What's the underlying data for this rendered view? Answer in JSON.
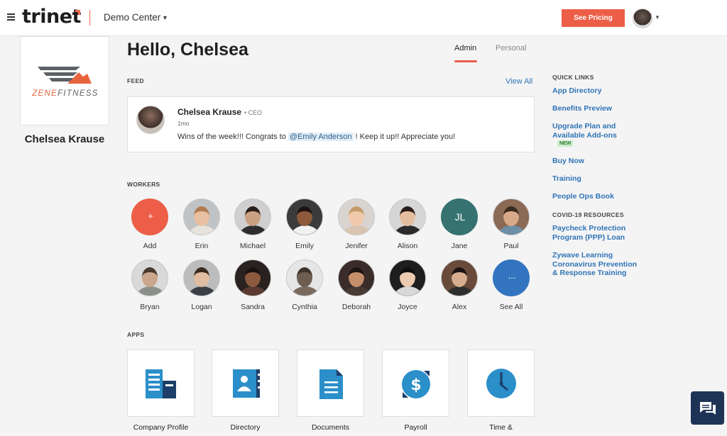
{
  "header": {
    "logo_text": "trinet",
    "demo_center_label": "Demo Center",
    "see_pricing_label": "See Pricing"
  },
  "company": {
    "logo_text_a": "ZENE",
    "logo_text_b": "FITNESS",
    "user_name": "Chelsea Krause"
  },
  "main": {
    "greeting": "Hello, Chelsea",
    "tabs": [
      {
        "label": "Admin",
        "active": true
      },
      {
        "label": "Personal",
        "active": false
      }
    ]
  },
  "feed": {
    "section_label": "FEED",
    "view_all_label": "View All",
    "post": {
      "author": "Chelsea Krause",
      "role": "• CEO",
      "time": "1mo",
      "message_before": "Wins of the week!!! Congrats to ",
      "mention": "@Emily Anderson",
      "message_after": " ! Keep it up!! Appreciate you!"
    }
  },
  "workers": {
    "section_label": "WORKERS",
    "items": [
      {
        "name": "Add",
        "kind": "add",
        "symbol": "+"
      },
      {
        "name": "Erin"
      },
      {
        "name": "Michael"
      },
      {
        "name": "Emily"
      },
      {
        "name": "Jenifer"
      },
      {
        "name": "Alison"
      },
      {
        "name": "Jane",
        "kind": "initials",
        "initials": "JL"
      },
      {
        "name": "Paul"
      },
      {
        "name": "Bryan"
      },
      {
        "name": "Logan"
      },
      {
        "name": "Sandra"
      },
      {
        "name": "Cynthia"
      },
      {
        "name": "Deborah"
      },
      {
        "name": "Joyce"
      },
      {
        "name": "Alex"
      },
      {
        "name": "See All",
        "kind": "more",
        "symbol": "..."
      }
    ]
  },
  "apps": {
    "section_label": "APPS",
    "items": [
      {
        "label": "Company Profile",
        "icon": "company-profile-icon"
      },
      {
        "label": "Directory",
        "icon": "directory-icon"
      },
      {
        "label": "Documents",
        "icon": "documents-icon"
      },
      {
        "label": "Payroll",
        "icon": "payroll-icon"
      },
      {
        "label": "Time &",
        "icon": "time-icon"
      }
    ]
  },
  "quick_links": {
    "heading": "QUICK LINKS",
    "items": [
      "App Directory",
      "Benefits Preview",
      "Upgrade Plan and\nAvailable Add-ons",
      "Buy Now",
      "Training",
      "People Ops Book"
    ],
    "new_badge": "NEW",
    "covid_heading": "COVID-19 RESOURCES",
    "covid_items": [
      "Paycheck Protection\nProgram (PPP) Loan",
      "Zywave Learning\nCoronavirus Prevention\n& Response Training"
    ]
  },
  "colors": {
    "accent": "#ec5e47",
    "link": "#2f74b5",
    "app_icon": "#2b8fc9",
    "chat": "#1e3356"
  }
}
